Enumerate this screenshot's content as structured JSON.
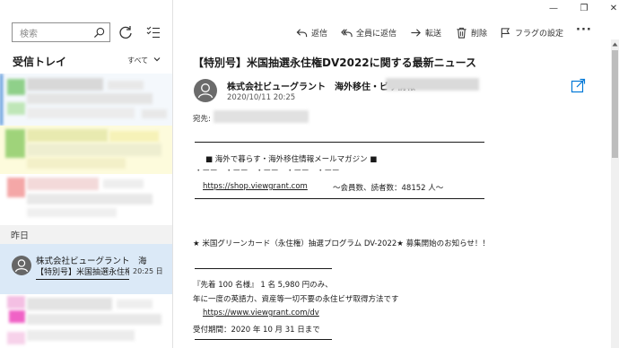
{
  "window": {
    "minimize_glyph": "—",
    "maximize_glyph": "❐",
    "close_glyph": "✕"
  },
  "sidebar": {
    "search_placeholder": "検索",
    "folder_title": "受信トレイ",
    "filter_label": "すべて",
    "date_group": "昨日",
    "selected_message": {
      "sender": "株式会社ビューグラント　海",
      "subject": "【特別号】米国抽選永住権",
      "time": "20:25 日"
    }
  },
  "toolbar": {
    "reply": "返信",
    "reply_all": "全員に返信",
    "forward": "転送",
    "delete": "削除",
    "flag": "フラグの設定",
    "more": "···"
  },
  "reading": {
    "subject": "【特別号】米国抽選永住権DV2022に関する最新ニュース",
    "sender": "株式会社ビューグラント　海外移住・ビザ情報",
    "date": "2020/10/11 20:25",
    "to_label": "宛先:",
    "body": {
      "magazine_title": "■ 海外で暮らす・海外移住情報メールマガジン ■",
      "divider_dashes": "・ーー　・ーー　・ーー　・ーー　・ーー",
      "shop_url": "https://shop.viewgrant.com",
      "member_info": "〜会員数、読者数：48152 人〜",
      "announcement": "★ 米国グリーンカード（永住権）抽選プログラム DV-2022★ 募集開始のお知らせ！！",
      "limit_line": "『先着 100 名様』 1 名 5,980 円のみ、",
      "desc_line": "年に一度の英語力、資産等一切不要の永住ビザ取得方法です",
      "dv_url": "https://www.viewgrant.com/dv",
      "deadline": "受付期間：2020 年 10 月 31 日まで"
    }
  },
  "colors": {
    "selected_bg": "#dbe9f7",
    "avatar_gray": "#666666",
    "accent_blue": "#0078d7"
  }
}
